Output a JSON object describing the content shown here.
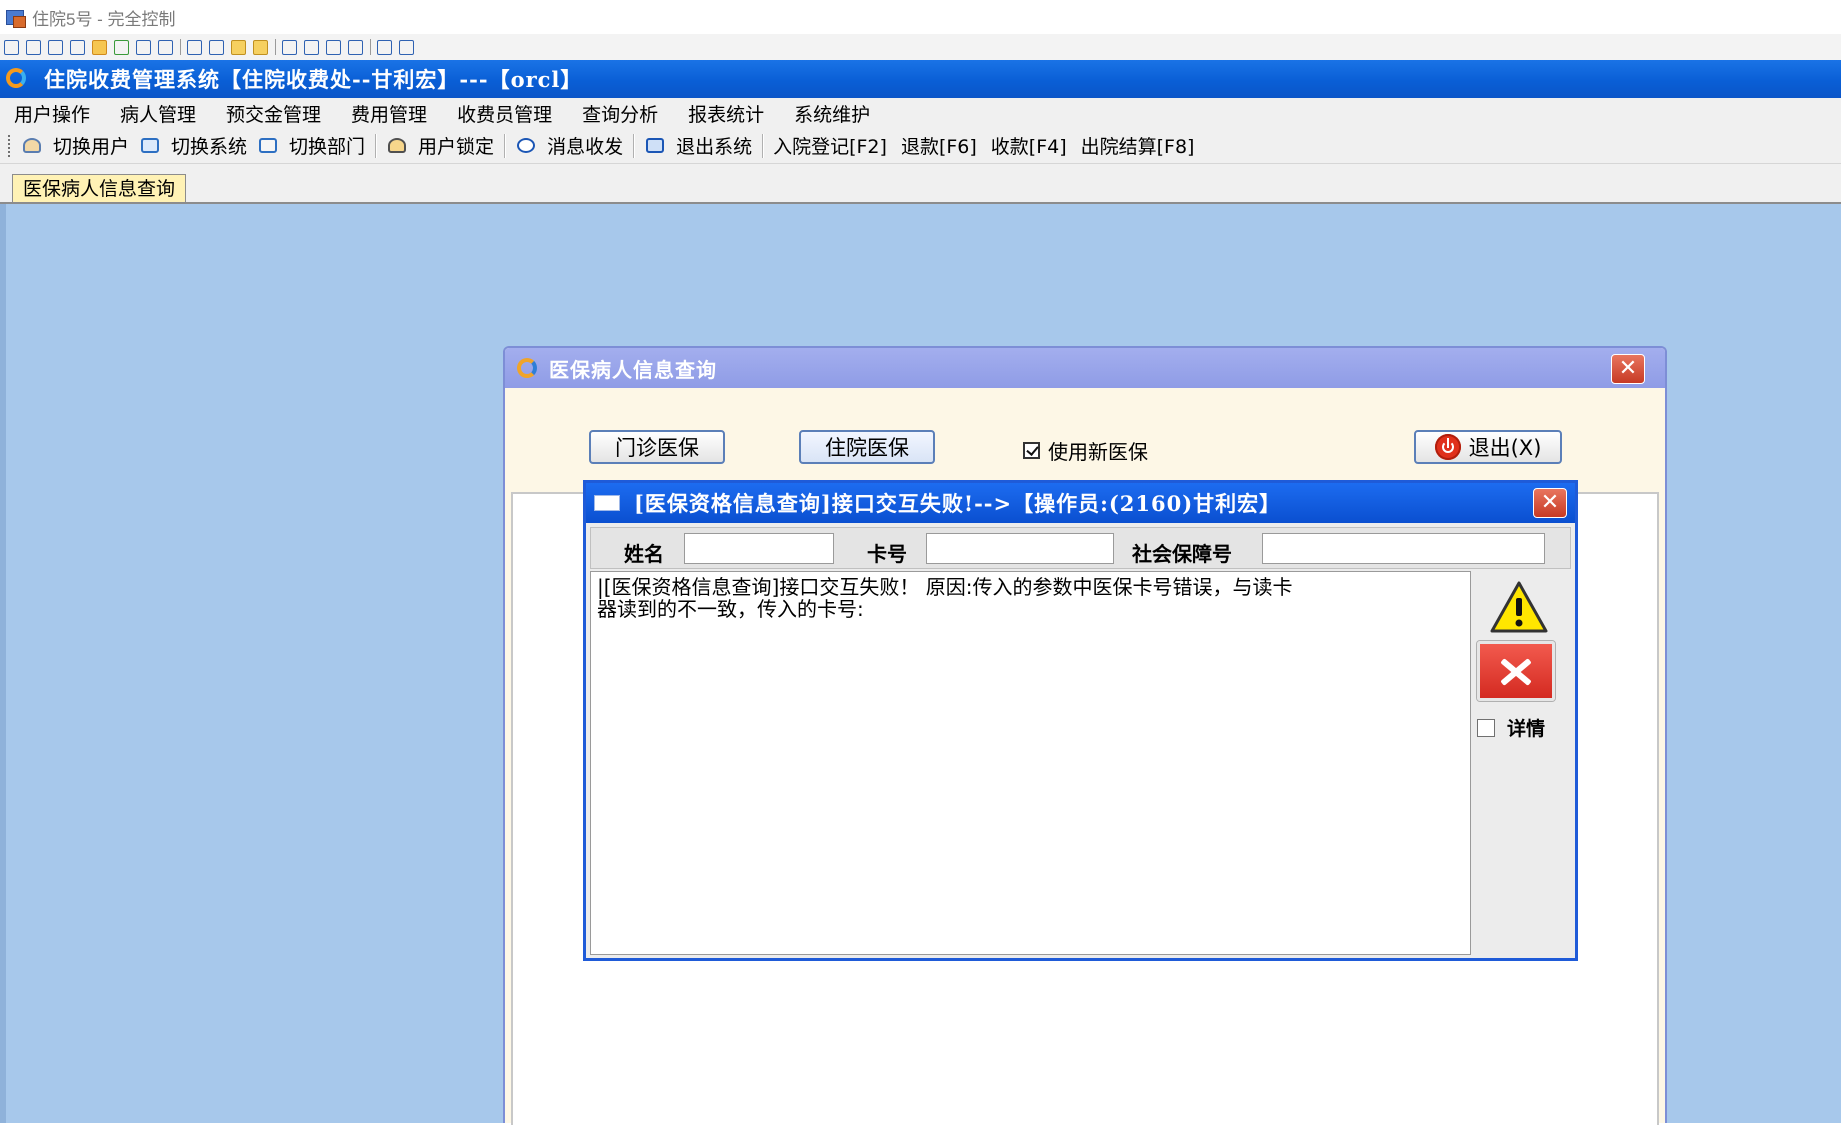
{
  "remote_window": {
    "title": "住院5号 - 完全控制"
  },
  "app": {
    "title": "住院收费管理系统【住院收费处--甘利宏】---【orcl】"
  },
  "menu": {
    "items": [
      "用户操作",
      "病人管理",
      "预交金管理",
      "费用管理",
      "收费员管理",
      "查询分析",
      "报表统计",
      "系统维护"
    ]
  },
  "toolbar": {
    "switch_user": "切换用户",
    "switch_system": "切换系统",
    "switch_dept": "切换部门",
    "user_lock": "用户锁定",
    "messages": "消息收发",
    "exit_system": "退出系统",
    "admission": "入院登记[F2]",
    "refund": "退款[F6]",
    "collect": "收款[F4]",
    "discharge": "出院结算[F8]"
  },
  "tabs": {
    "active": "医保病人信息查询"
  },
  "outer_dialog": {
    "title": "医保病人信息查询",
    "outpatient_button": "门诊医保",
    "inpatient_button": "住院医保",
    "use_new_insurance_label": "使用新医保",
    "use_new_insurance_checked": true,
    "exit_button": "退出(X)",
    "close_glyph": "✕"
  },
  "error_dialog": {
    "title": "[医保资格信息查询]接口交互失败!-->【操作员:(2160)甘利宏】",
    "name_label": "姓名",
    "name_value": "",
    "card_label": "卡号",
    "card_value": "",
    "ssn_label": "社会保障号",
    "ssn_value": "",
    "message": "|[医保资格信息查询]接口交互失败！ 原因:传入的参数中医保卡号错误，与读卡\n器读到的不一致，传入的卡号:",
    "detail_label": "详情",
    "detail_checked": false,
    "close_glyph": "✕"
  },
  "colors": {
    "app_titlebar": "#0a5fd6",
    "workspace": "#a7c8eb",
    "outer_dialog_title": "#8f9ce6",
    "error_dialog_title": "#0a4fd0",
    "close_button": "#c73a24",
    "tab_active": "#fff2b5"
  },
  "icons": [
    "app-window-icon",
    "app-logo-icon",
    "switch-user-icon",
    "switch-system-icon",
    "switch-dept-icon",
    "user-lock-icon",
    "info-icon",
    "exit-icon",
    "power-icon",
    "warning-icon",
    "error-icon",
    "close-icon"
  ]
}
